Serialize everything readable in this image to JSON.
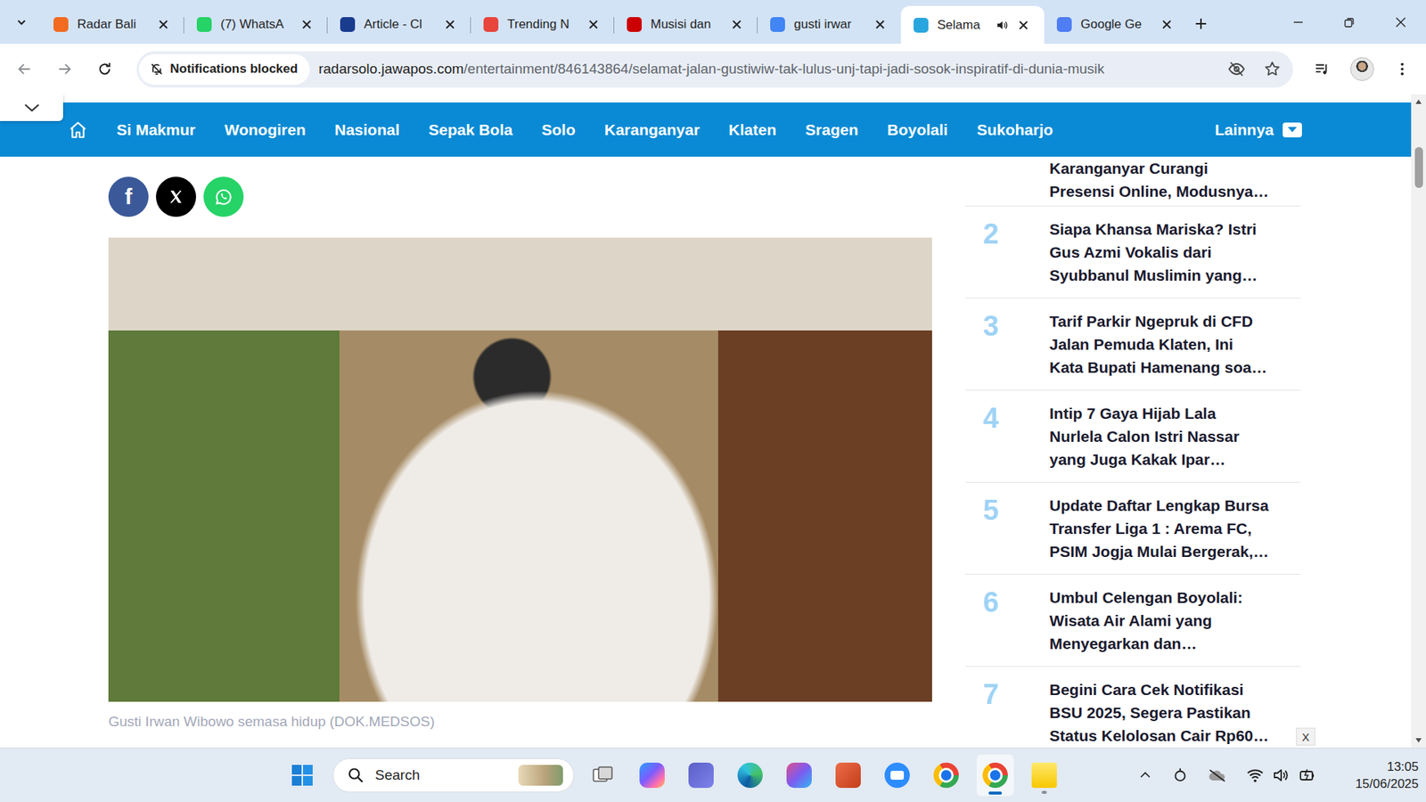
{
  "browser": {
    "tabs": [
      {
        "label": "Radar Bali",
        "selected": false,
        "audio": false,
        "color": "#f26b21"
      },
      {
        "label": "(7) WhatsA",
        "selected": false,
        "audio": false,
        "color": "#25d366"
      },
      {
        "label": "Article - Cl",
        "selected": false,
        "audio": false,
        "color": "#1a3c8f"
      },
      {
        "label": "Trending N",
        "selected": false,
        "audio": false,
        "color": "#e8453c"
      },
      {
        "label": "Musisi dan",
        "selected": false,
        "audio": false,
        "color": "#cc0000"
      },
      {
        "label": "gusti irwar",
        "selected": false,
        "audio": false,
        "color": "#4285f4"
      },
      {
        "label": "Selama",
        "selected": true,
        "audio": true,
        "color": "#2aa6de"
      },
      {
        "label": "Google Ge",
        "selected": false,
        "audio": false,
        "color": "#4f7df3"
      }
    ],
    "omnibox": {
      "chip": "Notifications blocked",
      "host": "radarsolo.jawapos.com",
      "path": "/entertainment/846143864/selamat-jalan-gustiwiw-tak-lulus-unj-tapi-jadi-sosok-inspiratif-di-dunia-musik",
      "bookmarked": false
    }
  },
  "page": {
    "nav": {
      "items": [
        "Si Makmur",
        "Wonogiren",
        "Nasional",
        "Sepak Bola",
        "Solo",
        "Karanganyar",
        "Klaten",
        "Sragen",
        "Boyolali",
        "Sukoharjo"
      ],
      "more": "Lainnya"
    },
    "share": [
      {
        "kind": "facebook",
        "glyph": "f",
        "color": "#3b5998"
      },
      {
        "kind": "x",
        "color": "#000000"
      },
      {
        "kind": "whatsapp",
        "color": "#25d366"
      }
    ],
    "photo": {
      "caption": "Gusti Irwan Wibowo semasa hidup (DOK.MEDSOS)"
    },
    "popular": [
      {
        "lines": [
          "Karanganyar Curangi",
          "Presensi Online, Modusnya…"
        ]
      },
      {
        "rank": "2",
        "lines": [
          "Siapa Khansa Mariska? Istri",
          "Gus Azmi Vokalis dari",
          "Syubbanul Muslimin yang…"
        ]
      },
      {
        "rank": "3",
        "lines": [
          "Tarif Parkir Ngepruk di CFD",
          "Jalan Pemuda Klaten, Ini",
          "Kata Bupati Hamenang soa…"
        ]
      },
      {
        "rank": "4",
        "lines": [
          "Intip 7 Gaya Hijab Lala",
          "Nurlela Calon Istri Nassar",
          "yang Juga Kakak Ipar…"
        ]
      },
      {
        "rank": "5",
        "lines": [
          "Update Daftar Lengkap Bursa",
          "Transfer Liga 1 : Arema FC,",
          "PSIM Jogja Mulai Bergerak,…"
        ]
      },
      {
        "rank": "6",
        "lines": [
          "Umbul Celengan Boyolali:",
          "Wisata Air Alami yang",
          "Menyegarkan dan…"
        ]
      },
      {
        "rank": "7",
        "lines": [
          "Begini Cara Cek Notifikasi",
          "BSU 2025, Segera Pastikan",
          "Status Kelolosan Cair Rp60…"
        ]
      }
    ],
    "ad_close": "X"
  },
  "taskbar": {
    "search_placeholder": "Search",
    "apps": [
      {
        "kind": "task-view",
        "running": false,
        "active": false
      },
      {
        "kind": "copilot",
        "running": false,
        "active": false
      },
      {
        "kind": "teams",
        "running": false,
        "active": false
      },
      {
        "kind": "edge",
        "running": false,
        "active": false
      },
      {
        "kind": "m365",
        "running": false,
        "active": false
      },
      {
        "kind": "powerpoint",
        "running": false,
        "active": false
      },
      {
        "kind": "zoom",
        "running": false,
        "active": false
      },
      {
        "kind": "chrome",
        "running": false,
        "active": false
      },
      {
        "kind": "chrome",
        "running": true,
        "active": true
      },
      {
        "kind": "sticky-notes",
        "running": true,
        "active": false
      }
    ],
    "time": "13:05",
    "date": "15/06/2025"
  }
}
